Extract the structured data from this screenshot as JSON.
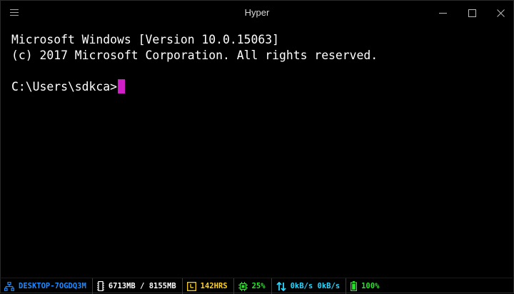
{
  "window": {
    "title": "Hyper"
  },
  "terminal": {
    "lines": [
      "Microsoft Windows [Version 10.0.15063]",
      "(c) 2017 Microsoft Corporation. All rights reserved.",
      "",
      "C:\\Users\\sdkca>"
    ]
  },
  "statusbar": {
    "hostname": "DESKTOP-7OGDQ3M",
    "memory": "6713MB / 8155MB",
    "uptime": "142HRS",
    "cpu": "25%",
    "network": "0kB/s 0kB/s",
    "battery": "100%"
  },
  "colors": {
    "cursor": "#d01fc8",
    "hostname": "#1e8bff",
    "uptime": "#ffd21a",
    "cpu": "#26e426",
    "network": "#29d6ff",
    "battery": "#26e426"
  },
  "icons": [
    "hamburger-menu-icon",
    "minimize-icon",
    "maximize-icon",
    "close-icon",
    "network-icon",
    "memory-icon",
    "clock-icon",
    "cpu-icon",
    "network-arrows-icon",
    "battery-icon"
  ]
}
